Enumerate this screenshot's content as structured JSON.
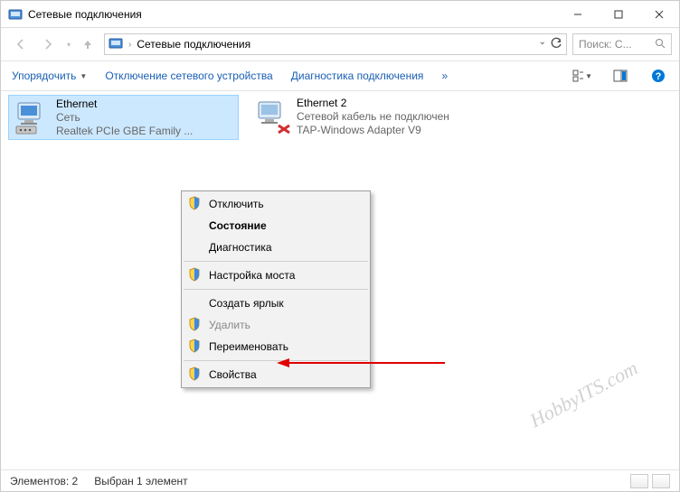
{
  "window": {
    "title": "Сетевые подключения"
  },
  "address": {
    "location": "Сетевые подключения"
  },
  "search": {
    "placeholder": "Поиск: С..."
  },
  "toolbar": {
    "organize": "Упорядочить",
    "disable": "Отключение сетевого устройства",
    "diagnose": "Диагностика подключения",
    "more": "»"
  },
  "adapters": [
    {
      "name": "Ethernet",
      "status": "Сеть",
      "device": "Realtek PCIe GBE Family ...",
      "selected": true
    },
    {
      "name": "Ethernet 2",
      "status": "Сетевой кабель не подключен",
      "device": "TAP-Windows Adapter V9",
      "selected": false
    }
  ],
  "context_menu": {
    "items": [
      {
        "label": "Отключить",
        "icon": "shield",
        "bold": false,
        "disabled": false
      },
      {
        "label": "Состояние",
        "icon": "",
        "bold": true,
        "disabled": false
      },
      {
        "label": "Диагностика",
        "icon": "",
        "bold": false,
        "disabled": false
      },
      {
        "sep": true
      },
      {
        "label": "Настройка моста",
        "icon": "shield",
        "bold": false,
        "disabled": false
      },
      {
        "sep": true
      },
      {
        "label": "Создать ярлык",
        "icon": "",
        "bold": false,
        "disabled": false
      },
      {
        "label": "Удалить",
        "icon": "shield",
        "bold": false,
        "disabled": true
      },
      {
        "label": "Переименовать",
        "icon": "shield",
        "bold": false,
        "disabled": false
      },
      {
        "sep": true
      },
      {
        "label": "Свойства",
        "icon": "shield",
        "bold": false,
        "disabled": false
      }
    ]
  },
  "statusbar": {
    "count_label": "Элементов: 2",
    "selection_label": "Выбран 1 элемент"
  },
  "watermark": "HobbyITS.com"
}
